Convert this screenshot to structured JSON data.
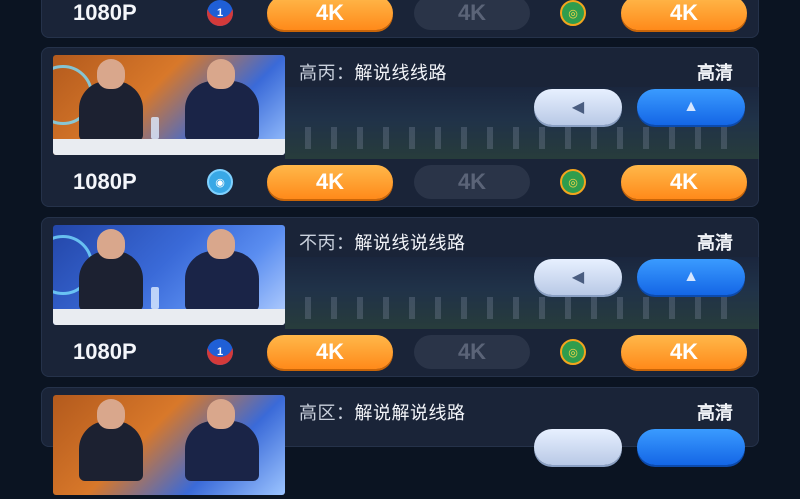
{
  "top_row": {
    "resolution": "1080P",
    "left_pill": "4K",
    "middle_pill": "4K",
    "right_pill": "4K"
  },
  "cards": [
    {
      "route_prefix": "高丙：",
      "route_name": "解说线线路",
      "quality": "高清",
      "resolution": "1080P",
      "left_pill": "4K",
      "middle_pill": "4K",
      "right_pill": "4K"
    },
    {
      "route_prefix": "不丙：",
      "route_name": "解说线说线路",
      "quality": "高清",
      "resolution": "1080P",
      "left_pill": "4K",
      "middle_pill": "4K",
      "right_pill": "4K"
    },
    {
      "route_prefix": "高区：",
      "route_name": "解说解说线路",
      "quality": "高清"
    }
  ],
  "icons": {
    "left_button": "triangle-left-icon",
    "right_button": "triangle-up-icon"
  },
  "colors": {
    "accent_orange": "#ff8a1a",
    "accent_blue": "#1466e6",
    "card_bg": "#1a2438"
  }
}
